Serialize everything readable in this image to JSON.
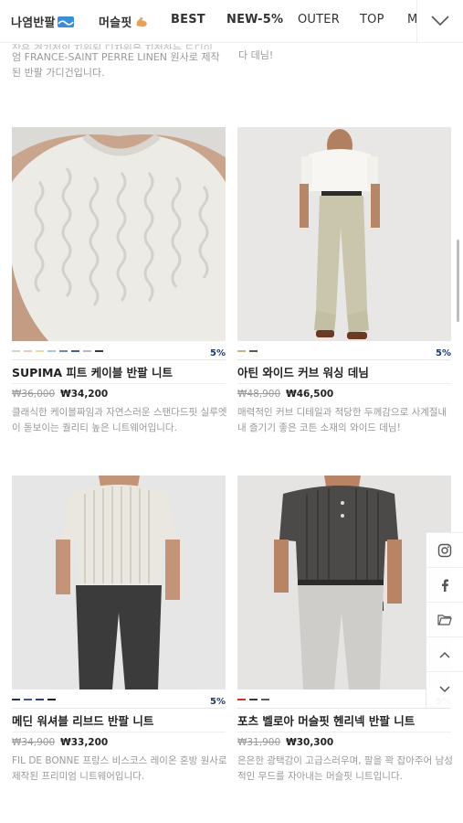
{
  "nav": {
    "items": [
      "나염반팔",
      "머슬핏",
      "BEST",
      "NEW-5%",
      "OUTER",
      "TOP",
      "M"
    ],
    "more_icon": "chevron-down-icon"
  },
  "top_cut": {
    "left_lines": [
      "잡은 경기정의 지원된 디자원을 지정하는 드디이",
      "엄 FRANCE-SAINT PERRE LINEN 원사로 제작",
      "된 반팔 가디건입니다."
    ],
    "right_lines": [
      "다 데님!"
    ]
  },
  "products": [
    {
      "name": "SUPIMA 피트 케이블 반팔 니트",
      "old_price": "₩36,000",
      "price": "₩34,200",
      "discount": "5%",
      "desc": "클래식한 케이블짜임과 자연스러운 스탠다드핏 실루엣이 돋보이는 퀄리티 높은 니트웨어입니다.",
      "swatches": [
        "#d9d4c8",
        "#f2c9b8",
        "#e7dd9a",
        "#a9c6e0",
        "#6a86b3",
        "#4a5c86",
        "#b8b8b8",
        "#3a3a3a"
      ]
    },
    {
      "name": "아틴 와이드 커브 워싱 데님",
      "old_price": "₩48,900",
      "price": "₩46,500",
      "discount": "5%",
      "desc": "매력적인 커브 디테일과 적당한 두께감으로 사계절내내 즐기기 좋은 코튼 소재의 와이드 데님!",
      "swatches": [
        "#c9b58a",
        "#5a5a4a"
      ]
    },
    {
      "name": "메딘 워셔블 리브드 반팔 니트",
      "old_price": "₩34,900",
      "price": "₩33,200",
      "discount": "5%",
      "desc": "FIL DE BONNE 프랑스 비스코스 레이온 혼방 원사로 제작된 프리미엄 니트웨어입니다.",
      "swatches": [
        "#26324f",
        "#3d5a8a",
        "#2a3f6b",
        "#1c1c1c"
      ]
    },
    {
      "name": "포츠 벨로아 머슬핏 헨리넥 반팔 니트",
      "old_price": "₩31,900",
      "price": "₩30,300",
      "discount": "5%",
      "desc": "은은한 광택감이 고급스러우며, 팔을 꽉 잡아주어 남성적인 무드를 자아내는 머슬핏 니트입니다.",
      "swatches": [
        "#c0392b",
        "#3a3a3a",
        "#5a5a5a"
      ]
    }
  ],
  "side_buttons": [
    "instagram-icon",
    "facebook-icon",
    "folder-icon",
    "chevron-up-icon",
    "chevron-down-icon"
  ]
}
